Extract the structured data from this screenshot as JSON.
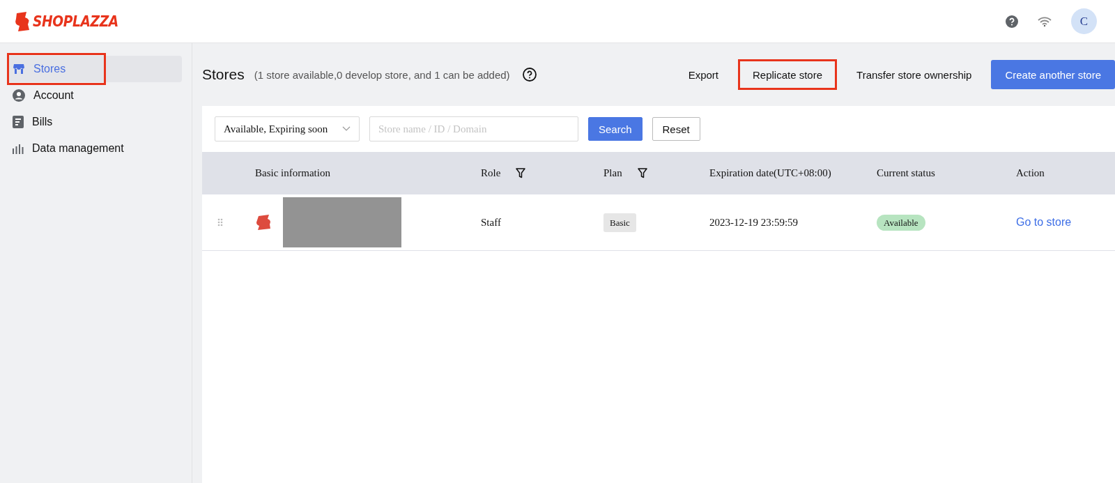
{
  "header": {
    "logo_text": "SHOPLAZZA",
    "avatar_letter": "C"
  },
  "sidebar": {
    "items": [
      {
        "label": "Stores",
        "selected": true,
        "highlighted": true
      },
      {
        "label": "Account",
        "selected": false,
        "highlighted": false
      },
      {
        "label": "Bills",
        "selected": false,
        "highlighted": false
      },
      {
        "label": "Data management",
        "selected": false,
        "highlighted": false
      }
    ]
  },
  "page": {
    "title": "Stores",
    "subtitle": "(1 store available,0 develop store, and 1 can be added)",
    "actions": [
      {
        "label": "Export",
        "kind": "text",
        "highlighted": false
      },
      {
        "label": "Replicate store",
        "kind": "text",
        "highlighted": true
      },
      {
        "label": "Transfer store ownership",
        "kind": "text",
        "highlighted": false
      },
      {
        "label": "Create another store",
        "kind": "primary",
        "highlighted": false
      }
    ]
  },
  "filters": {
    "status_select": "Available, Expiring soon",
    "search": {
      "placeholder": "Store name / ID / Domain"
    },
    "search_button": "Search",
    "reset_button": "Reset"
  },
  "table": {
    "columns": [
      {
        "label": "Basic information",
        "filter": false
      },
      {
        "label": "Role",
        "filter": true
      },
      {
        "label": "Plan",
        "filter": true
      },
      {
        "label": "Expiration date(UTC+08:00)",
        "filter": false
      },
      {
        "label": "Current status",
        "filter": false
      },
      {
        "label": "Action",
        "filter": false
      }
    ],
    "rows": [
      {
        "role": "Staff",
        "plan": "Basic",
        "expiration": "2023-12-19 23:59:59",
        "status": "Available",
        "action": "Go to store"
      }
    ]
  }
}
